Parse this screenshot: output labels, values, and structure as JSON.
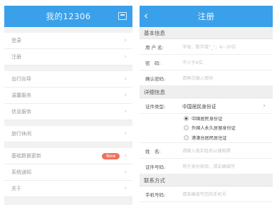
{
  "left_screen": {
    "title": "我的12306",
    "items": [
      {
        "label": "登录"
      },
      {
        "label": "注册"
      },
      {
        "label": "出行向导"
      },
      {
        "label": "温馨服务"
      },
      {
        "label": "信息服务"
      },
      {
        "label": "旅行休闲"
      },
      {
        "label": "基础数据更新",
        "badge": "New"
      },
      {
        "label": "系统通知"
      },
      {
        "label": "关于"
      }
    ]
  },
  "right_screen": {
    "title": "注册",
    "basic_section": "基本信息",
    "username_label": "用 户 名:",
    "username_placeholder": "字母、数字或\"_\"，6~30位",
    "password_label": "密　码:",
    "password_placeholder": "不少于6位",
    "confirm_label": "确认密码:",
    "confirm_placeholder": "请再次输入密码",
    "detail_section": "详细信息",
    "idtype_label": "证件类型:",
    "idtype_value": "中国居民身份证",
    "id_options": [
      "中国居民身份证",
      "外国人永久居留身份证",
      "港澳台居民居住证"
    ],
    "name_label": "姓　名:",
    "name_placeholder": "请输入真实姓名以便购票",
    "idnumber_label": "证件号码:",
    "idnumber_placeholder": "用于身份核验，请正确填写",
    "contact_section": "联系方式",
    "phone_label": "手机号码:",
    "phone_placeholder": "请准确填写您的手机号"
  }
}
